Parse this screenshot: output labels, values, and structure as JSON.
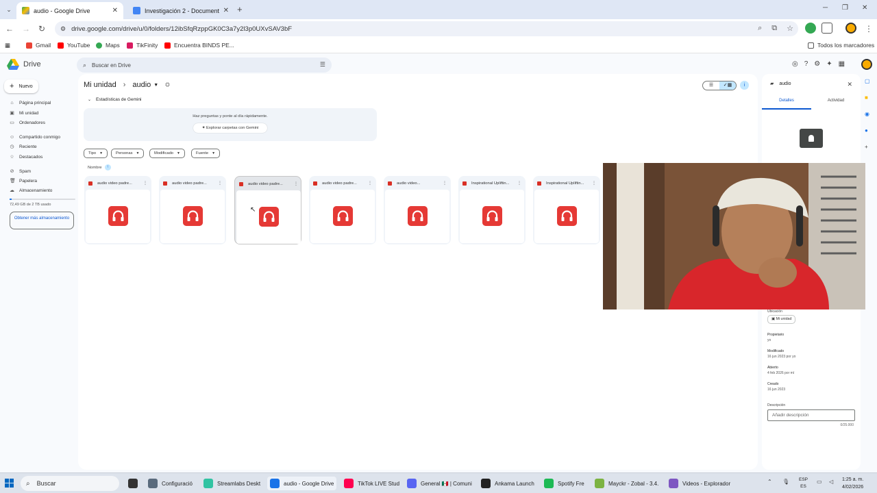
{
  "browser": {
    "tabs": [
      {
        "title": "audio - Google Drive",
        "active": true
      },
      {
        "title": "Investigación 2 - Documentos de Google",
        "active": false
      }
    ],
    "url": "drive.google.com/drive/u/0/folders/12ibSfqRzppGK0C3a7y2l3p0UXvSAV3bF",
    "bookmarks": [
      "Gmail",
      "YouTube",
      "Maps",
      "TikFinity",
      "Encuentra BINDS PE..."
    ],
    "all_bookmarks": "Todos los marcadores"
  },
  "drive": {
    "logo": "Drive",
    "search_placeholder": "Buscar en Drive",
    "new_label": "Nuevo",
    "sidebar": [
      {
        "label": "Página principal",
        "icon": "home-icon"
      },
      {
        "label": "Mi unidad",
        "icon": "drive-icon"
      },
      {
        "label": "Ordenadores",
        "icon": "computer-icon"
      },
      {
        "label": "Compartido conmigo",
        "icon": "shared-icon"
      },
      {
        "label": "Reciente",
        "icon": "clock-icon"
      },
      {
        "label": "Destacados",
        "icon": "star-icon"
      },
      {
        "label": "Spam",
        "icon": "spam-icon"
      },
      {
        "label": "Papelera",
        "icon": "trash-icon"
      },
      {
        "label": "Almacenamiento",
        "icon": "cloud-icon"
      }
    ],
    "storage_text": "72,49 GB de 2 TB usado",
    "storage_fraction": 0.035,
    "more_storage": "Obtener más almacenamiento",
    "breadcrumb": {
      "root": "Mi unidad",
      "current": "audio"
    },
    "gemini": {
      "toggle": "Estadísticas de Gemini",
      "question": "Haz preguntas y ponte al día rápidamente.",
      "explore": "Explorar carpetas con Gemini"
    },
    "filters": [
      "Tipo",
      "Personas",
      "Modificado",
      "Fuente"
    ],
    "sort_label": "Nombre",
    "files": [
      {
        "name": "audio video padre..."
      },
      {
        "name": "audio video padre..."
      },
      {
        "name": "audio video padre..."
      },
      {
        "name": "audio video padre..."
      },
      {
        "name": "audio video..."
      },
      {
        "name": "Inspirational Upliftin..."
      },
      {
        "name": "Inspirational Upliftin..."
      }
    ]
  },
  "details": {
    "title": "audio",
    "tabs": [
      "Detalles",
      "Actividad"
    ],
    "location_label": "Ubicación",
    "location": "Mi unidad",
    "meta": [
      {
        "k": "Propietario",
        "v": "yo"
      },
      {
        "k": "Modificado",
        "v": "16 jun 2023 por yo"
      },
      {
        "k": "Abierto",
        "v": "4 feb 2026 por mí"
      },
      {
        "k": "Creado",
        "v": "16 jun 2023"
      }
    ],
    "desc_label": "Descripción",
    "desc_placeholder": "Añadir descripción",
    "desc_count": "0/25.000"
  },
  "taskbar": {
    "search": "Buscar",
    "apps": [
      {
        "label": "Configuració",
        "color": "#5a6b7d"
      },
      {
        "label": "Streamlabs Deskt",
        "color": "#31c3a2"
      },
      {
        "label": "audio - Google Drive",
        "color": "#1a73e8"
      },
      {
        "label": "TikTok LIVE Stud",
        "color": "#ff0050"
      },
      {
        "label": "General 🇲🇽 | Comuni",
        "color": "#5865f2"
      },
      {
        "label": "Ankama Launch",
        "color": "#222222"
      },
      {
        "label": "Spotify Fre",
        "color": "#1db954"
      },
      {
        "label": "Mayckr - Zobal - 3.4.",
        "color": "#7cb342"
      },
      {
        "label": "Videos - Explorador",
        "color": "#7e57c2"
      }
    ],
    "lang_top": "ESP",
    "lang_bottom": "ES",
    "time": "1:25 a. m.",
    "date": "4/02/2026"
  }
}
